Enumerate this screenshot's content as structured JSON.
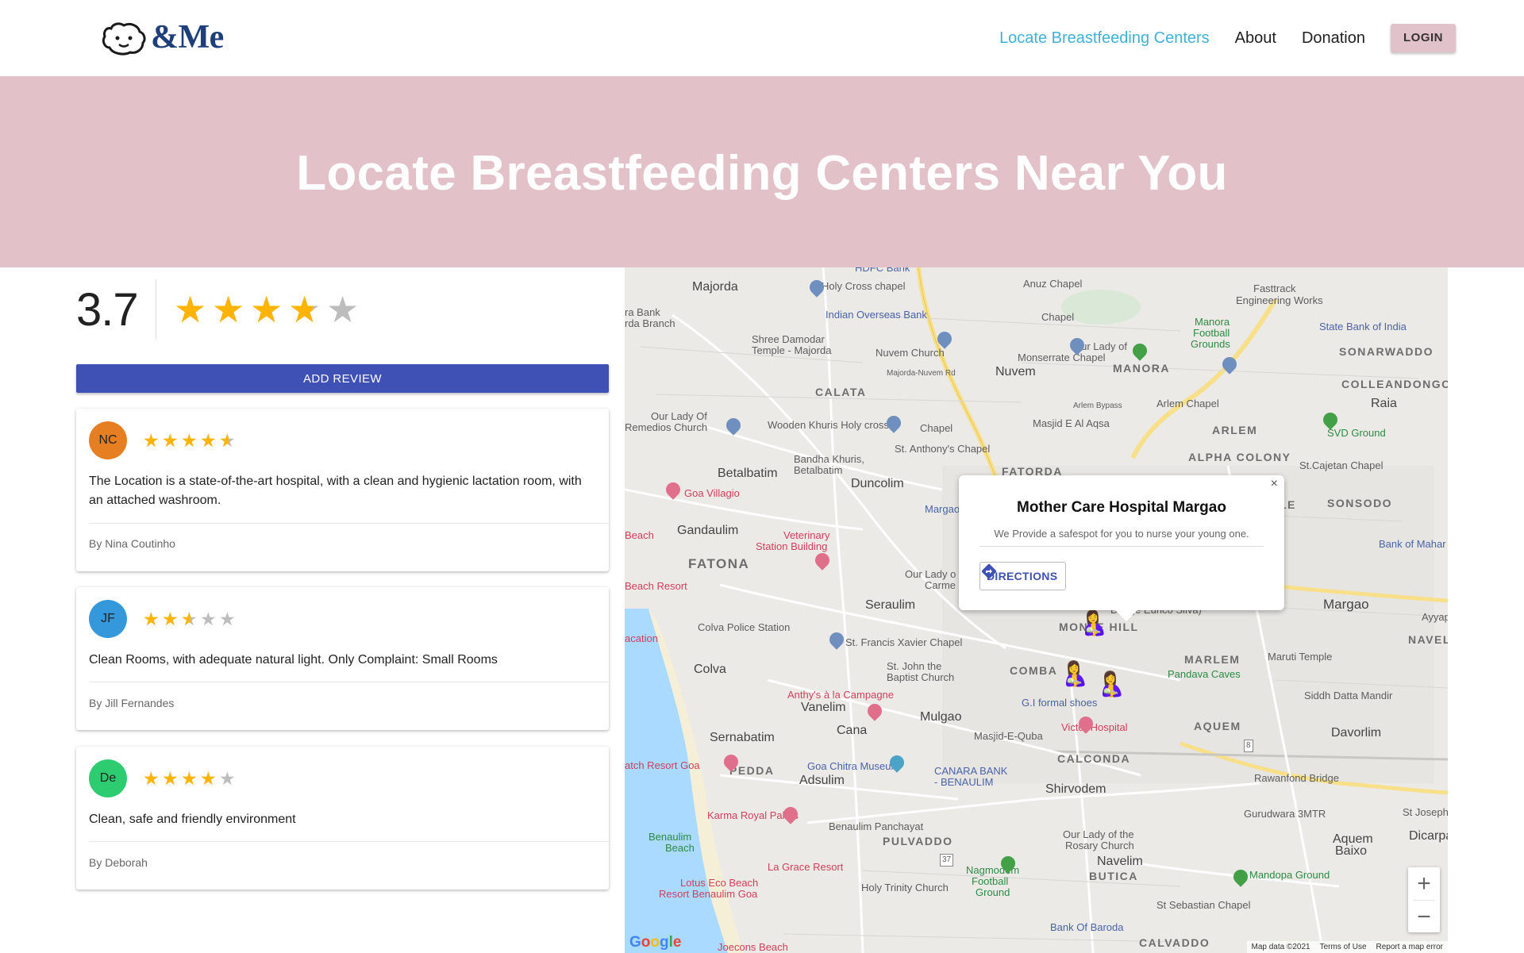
{
  "brand": {
    "logo_text": "&Me"
  },
  "nav": {
    "items": [
      {
        "label": "Locate Breastfeeding Centers",
        "active": true
      },
      {
        "label": "About",
        "active": false
      },
      {
        "label": "Donation",
        "active": false
      }
    ],
    "login_label": "LOGIN"
  },
  "hero": {
    "title": "Locate Breastfeeding Centers Near You"
  },
  "rating": {
    "average": "3.7",
    "average_value": 3.7
  },
  "add_review_label": "ADD REVIEW",
  "reviews": [
    {
      "initials": "NC",
      "avatar_color": "#e67e22",
      "stars": 4.5,
      "text": "The Location is a state-of-the-art hospital, with a clean and hygienic lactation room, with an attached washroom.",
      "author": "By Nina Coutinho"
    },
    {
      "initials": "JF",
      "avatar_color": "#3498db",
      "stars": 2.5,
      "text": "Clean Rooms, with adequate natural light. Only Complaint: Small Rooms",
      "author": "By Jill Fernandes"
    },
    {
      "initials": "De",
      "avatar_color": "#2ecc71",
      "stars": 4,
      "text": "Clean, safe and friendly environment",
      "author": "By Deborah"
    }
  ],
  "map": {
    "info_window": {
      "title": "Mother Care Hospital Margao",
      "description": "We Provide a safespot for you to nurse your young one.",
      "directions_label": "DIRECTIONS",
      "close": "×"
    },
    "labels": {
      "hdfc": "HDFC Bank",
      "majorda": "Majorda",
      "holy_cross": "Holy Cross chapel",
      "anuz": "Anuz Chapel",
      "fasttrack": "Fasttrack",
      "engineering": "Engineering Works",
      "bank_branch_1": "ra Bank",
      "bank_branch_2": "rda Branch",
      "iob": "Indian Overseas Bank",
      "chapel": "Chapel",
      "manora_fg_1": "Manora",
      "manora_fg_2": "Football",
      "manora_fg_3": "Grounds",
      "sbi": "State Bank of India",
      "shree_1": "Shree Damodar",
      "shree_2": "Temple - Majorda",
      "nuvem_church": "Nuvem Church",
      "ourlady_m1": "Our Lady of",
      "ourlady_m2": "Monserrate Chapel",
      "manora": "MANORA",
      "sonarwaddo": "SONARWADDO",
      "majorda_nuvem": "Majorda-Nuvem Rd",
      "nuvem": "Nuvem",
      "calata": "CALATA",
      "arlem_bypass": "Arlem Bypass",
      "arlem_chapel": "Arlem Chapel",
      "colleandongo": "COLLEANDONGO",
      "raia": "Raia",
      "ourlady_r1": "Our Lady Of",
      "ourlady_r2": "Remedios Church",
      "wooden": "Wooden Khuris Holy cross",
      "chapel2": "Chapel",
      "masjid": "Masjid E Al Aqsa",
      "arlem": "ARLEM",
      "svd": "SVD Ground",
      "bandha_1": "Bandha Khuris,",
      "bandha_2": "Betalbatim",
      "st_anthony": "St. Anthony's Chapel",
      "alpha": "ALPHA COLONY",
      "st_cajetan": "St.Cajetan Chapel",
      "betalbatim": "Betalbatim",
      "duncolim": "Duncolim",
      "fatorda": "FATORDA",
      "goa_villagio": "Goa Villagio",
      "margao_short": "Margao",
      "le": "LE",
      "sonsodo": "SONSODO",
      "beach": "Beach",
      "gandaulim": "Gandaulim",
      "vet_1": "Veterinary",
      "vet_2": "Station Building",
      "bank_maha": "Bank of Mahar",
      "fatona": "FATONA",
      "ourlady_c1": "Our Lady o",
      "ourlady_c2": "Carme",
      "beach_resort": "Beach Resort",
      "seraulim": "Seraulim",
      "margao": "Margao",
      "ayyap": "Ayyap",
      "colva_police": "Colva Police Station",
      "monte_hill": "MONTE HILL",
      "navelim": "NAVELIM",
      "acation": "acation",
      "st_francis": "St. Francis Xavier Chapel",
      "maruti": "Maruti Temple",
      "st_john_1": "St. John the",
      "st_john_2": "Baptist Church",
      "comba": "COMBA",
      "marlem": "MARLEM",
      "colva": "Colva",
      "pandava": "Pandava Caves",
      "anthys": "Anthy's à la Campagne",
      "gi_formal": "G.I formal shoes",
      "siddh": "Siddh Datta Mandir",
      "vanelim": "Vanelim",
      "mulgao": "Mulgao",
      "victor": "Victor Hospital",
      "aquem": "AQUEM",
      "cana": "Cana",
      "masjid_quba": "Masjid-E-Quba",
      "davorlim": "Davorlim",
      "sernabatim": "Sernabatim",
      "calconda": "CALCONDA",
      "atch_resort": "atch Resort Goa",
      "pedda": "PEDDA",
      "goa_chitra": "Goa Chitra Museum",
      "adsulim": "Adsulim",
      "canara_1": "CANARA BANK",
      "canara_2": "- BENAULIM",
      "rawanfond": "Rawanfond Bridge",
      "shirvodem": "Shirvodem",
      "karma": "Karma Royal Palms",
      "gurudwara": "Gurudwara 3MTR",
      "st_joseph": "St Joseph",
      "benaulim_panch": "Benaulim Panchayat",
      "benaulim_1": "Benaulim",
      "benaulim_2": "Beach",
      "pulvaddo": "PULVADDO",
      "ourlady_rosary_1": "Our Lady of the",
      "ourlady_rosary_2": "Rosary Church",
      "aquem_baixo_1": "Aquem",
      "aquem_baixo_2": "Baixo",
      "dicarpa": "Dicarpa",
      "la_grace": "La Grace Resort",
      "navelim2": "Navelim",
      "butica": "BUTICA",
      "nagmodem_1": "Nagmodem",
      "nagmodem_2": "Football",
      "nagmodem_3": "Ground",
      "mandopa": "Mandopa Ground",
      "holy_trinity": "Holy Trinity Church",
      "lotus_1": "Lotus Eco Beach",
      "lotus_2": "Resort Benaulim Goa",
      "st_sebastian": "St Sebastian Chapel",
      "bank_baroda": "Bank Of Baroda",
      "calvaddo": "CALVADDO",
      "joecons": "Joecons Beach",
      "route_37": "37",
      "route_8": "8",
      "dudge": "Dudge Eurico Silva)"
    },
    "google_logo": "Google",
    "footer": {
      "map_data": "Map data ©2021",
      "terms": "Terms of Use",
      "report": "Report a map error"
    },
    "zoom_in": "+",
    "zoom_out": "−"
  }
}
